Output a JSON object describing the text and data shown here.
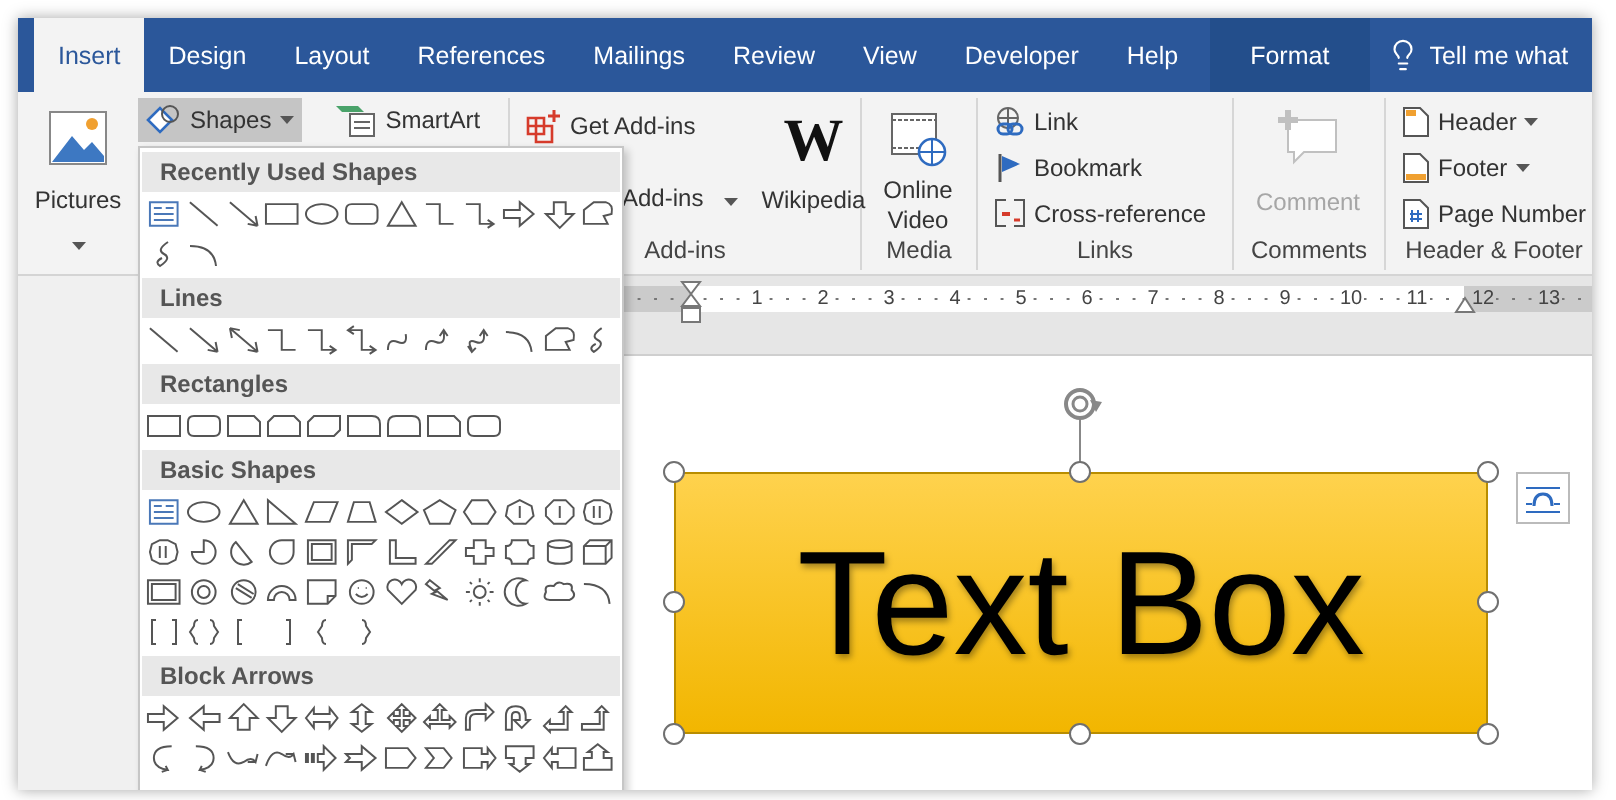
{
  "tabs": [
    {
      "label": "Insert",
      "selected": true,
      "kind": "tab"
    },
    {
      "label": "Design",
      "selected": false,
      "kind": "tab"
    },
    {
      "label": "Layout",
      "selected": false,
      "kind": "tab"
    },
    {
      "label": "References",
      "selected": false,
      "kind": "tab"
    },
    {
      "label": "Mailings",
      "selected": false,
      "kind": "tab"
    },
    {
      "label": "Review",
      "selected": false,
      "kind": "tab"
    },
    {
      "label": "View",
      "selected": false,
      "kind": "tab"
    },
    {
      "label": "Developer",
      "selected": false,
      "kind": "tab"
    },
    {
      "label": "Help",
      "selected": false,
      "kind": "tab"
    },
    {
      "label": "Format",
      "selected": false,
      "kind": "contextual"
    }
  ],
  "tell_me": {
    "label": "Tell me what"
  },
  "ribbon": {
    "illustrations": {
      "pictures": "Pictures",
      "shapes": {
        "label": "Shapes",
        "expanded": true
      },
      "smartart": "SmartArt"
    },
    "addins": {
      "get_addins": "Get Add-ins",
      "my_addins": "Add-ins",
      "wikipedia_logo": "W",
      "wikipedia": "Wikipedia",
      "label": "Add-ins"
    },
    "media": {
      "online_video": "Online Video",
      "label": "Media"
    },
    "links": {
      "items": [
        "Link",
        "Bookmark",
        "Cross-reference"
      ],
      "label": "Links"
    },
    "comments": {
      "comment": {
        "label": "Comment",
        "disabled": true
      },
      "label": "Comments"
    },
    "header_footer": {
      "items": [
        {
          "label": "Header",
          "dropdown": true
        },
        {
          "label": "Footer",
          "dropdown": true
        },
        {
          "label": "Page Number",
          "dropdown": false
        }
      ],
      "label": "Header & Footer"
    }
  },
  "shapes_menu": {
    "sections": [
      {
        "title": "Recently Used Shapes"
      },
      {
        "title": "Lines"
      },
      {
        "title": "Rectangles"
      },
      {
        "title": "Basic Shapes"
      },
      {
        "title": "Block Arrows"
      }
    ]
  },
  "ruler": {
    "labels": [
      "1",
      "2",
      "3",
      "4",
      "5",
      "6",
      "7",
      "8",
      "9",
      "10",
      "11",
      "12",
      "13"
    ]
  },
  "document": {
    "text_box": {
      "text": "Text Box",
      "selected": true
    }
  }
}
